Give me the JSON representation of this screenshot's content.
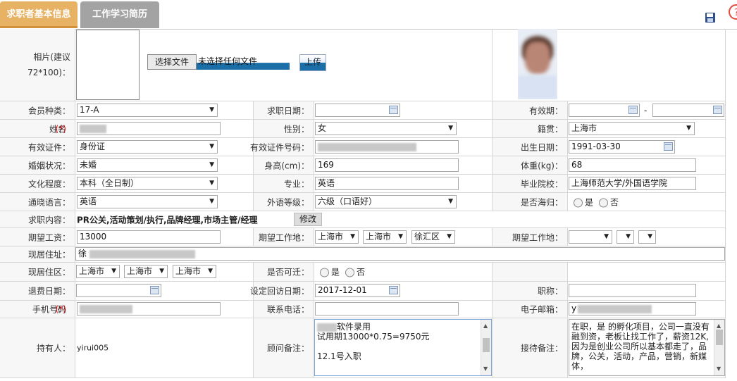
{
  "tabs": [
    {
      "label": "求职者基本信息",
      "active": true
    },
    {
      "label": "工作学习简历",
      "active": false
    }
  ],
  "photo": {
    "label": "相片(建议72*100)：",
    "choose_button": "选择文件",
    "file_status": "未选择任何文件",
    "upload_button": "上传"
  },
  "rows": {
    "member_type": {
      "label": "会员种类：",
      "value": "17-A"
    },
    "apply_date": {
      "label": "求职日期：",
      "value": ""
    },
    "valid_period": {
      "label": "有效期：",
      "from": "",
      "separator": "-",
      "to": ""
    },
    "name": {
      "label": "姓名",
      "required": "(*)",
      "colon": "："
    },
    "gender": {
      "label": "性别：",
      "value": "女"
    },
    "native": {
      "label": "籍贯：",
      "value": "上海市"
    },
    "id_type": {
      "label": "有效证件：",
      "value": "身份证"
    },
    "id_number": {
      "label": "有效证件号码："
    },
    "birth_date": {
      "label": "出生日期：",
      "value": "1991-03-30"
    },
    "marital": {
      "label": "婚姻状况：",
      "value": "未婚"
    },
    "height": {
      "label": "身高(cm)：",
      "value": "169"
    },
    "weight": {
      "label": "体重(kg)：",
      "value": "68"
    },
    "education": {
      "label": "文化程度：",
      "value": "本科（全日制）"
    },
    "major": {
      "label": "专业：",
      "value": "英语"
    },
    "school": {
      "label": "毕业院校：",
      "value": "上海师范大学/外国语学院"
    },
    "language": {
      "label": "通晓语言：",
      "value": "英语"
    },
    "foreign_level": {
      "label": "外语等级：",
      "value": "六级（口语好）"
    },
    "returnee": {
      "label": "是否海归：",
      "yes": "是",
      "no": "否"
    },
    "job_content": {
      "label": "求职内容：",
      "value": "PR公关,活动策划/执行,品牌经理,市场主管/经理",
      "edit_button": "修改"
    },
    "expected_salary": {
      "label": "期望工资：",
      "value": "13000"
    },
    "expected_location": {
      "label": "期望工作地：",
      "province": "上海市",
      "city": "上海市",
      "district": "徐汇区"
    },
    "expected_location2": {
      "label": "期望工作地：",
      "province": "",
      "city": "",
      "district": ""
    },
    "address": {
      "label": "现居住址：",
      "value": "徐"
    },
    "current_area": {
      "label": "现居住区：",
      "province": "上海市",
      "city": "上海市",
      "district": "上海市"
    },
    "relocate": {
      "label": "是否可迁：",
      "yes": "是",
      "no": "否"
    },
    "refund_date": {
      "label": "退费日期：",
      "value": ""
    },
    "revisit_date": {
      "label": "设定回访日期：",
      "value": "2017-12-01"
    },
    "title": {
      "label": "职称：",
      "value": ""
    },
    "mobile": {
      "label": "手机号码",
      "required": "(*)",
      "colon": "："
    },
    "phone": {
      "label": "联系电话：",
      "value": ""
    },
    "email": {
      "label": "电子邮箱：",
      "value": "y"
    },
    "holder": {
      "label": "持有人：",
      "value": "yirui005"
    },
    "consultant_note": {
      "label": "顾问备注：",
      "line1": "软件录用",
      "line2": "试用期13000*0.75=9750元",
      "line3": "",
      "line4": "12.1号入职"
    },
    "reception_note": {
      "label": "接待备注：",
      "text": "在职，是 的孵化项目，公司一直没有融到资，老板让找工作了，薪资12K,因为是创业公司所以基本都走了，品牌，公关，活动，产品，营销，新媒体，"
    }
  },
  "icons": {
    "save": "save-icon",
    "calendar": "calendar-icon",
    "dropdown": "chevron-down-icon"
  }
}
